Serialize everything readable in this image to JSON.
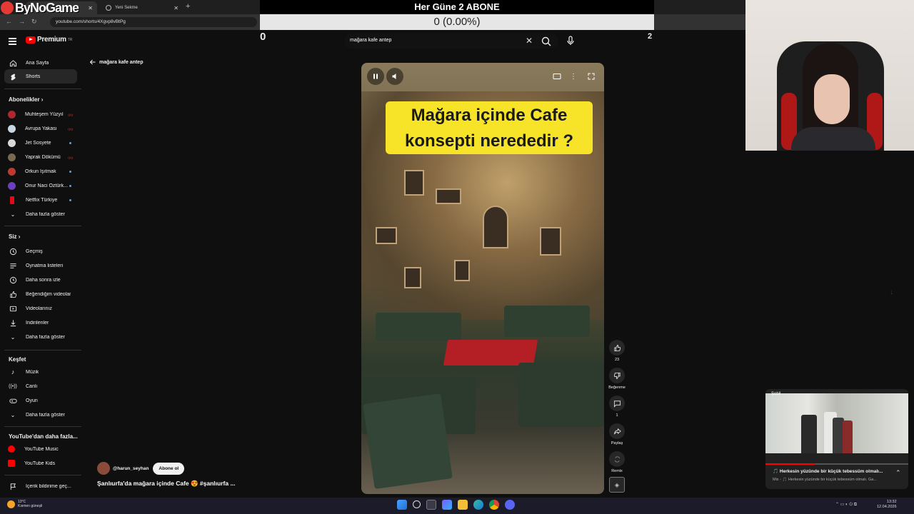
{
  "browser": {
    "tabs": [
      {
        "label": "ByNoGame"
      },
      {
        "label": "Yeni Sekme"
      }
    ],
    "url": "youtube.com/shorts/4Xgvp8vBtPg"
  },
  "overlay": {
    "title": "Her Güne 2 ABONE",
    "count": "0 (0.00%)",
    "left_value": "0",
    "right_value": "2"
  },
  "youtube": {
    "logo_text": "Premium",
    "logo_sup": "TR",
    "search_value": "mağara kafe antep",
    "back_label": "mağara kafe antep"
  },
  "sidebar": {
    "main": [
      {
        "label": "Ana Sayfa",
        "icon": "home-icon"
      },
      {
        "label": "Shorts",
        "icon": "shorts-icon"
      }
    ],
    "subscriptions_title": "Abonelikler",
    "subscriptions": [
      {
        "label": "Muhteşem Yüzyıl",
        "badge": "live",
        "color": "#b2262e"
      },
      {
        "label": "Avrupa Yakası",
        "badge": "live",
        "color": "#c7d6e3"
      },
      {
        "label": "Jet Sosyete",
        "badge": "dot",
        "color": "#d8d8d8"
      },
      {
        "label": "Yaprak Dökümü",
        "badge": "live",
        "color": "#7a6a4f"
      },
      {
        "label": "Orkun Işıtmak",
        "badge": "dot",
        "color": "#c0392b"
      },
      {
        "label": "Onur Naci Öztürk...",
        "badge": "dot",
        "color": "#6c3fbf"
      },
      {
        "label": "Netflix Türkiye",
        "badge": "dot",
        "color": "#e50914"
      }
    ],
    "show_more": "Daha fazla göster",
    "you_title": "Siz",
    "you": [
      {
        "label": "Geçmiş",
        "icon": "history-icon"
      },
      {
        "label": "Oynatma listeleri",
        "icon": "playlists-icon"
      },
      {
        "label": "Daha sonra izle",
        "icon": "watch-later-icon"
      },
      {
        "label": "Beğendiğim videolar",
        "icon": "liked-videos-icon"
      },
      {
        "label": "Videolarınız",
        "icon": "your-videos-icon"
      },
      {
        "label": "İndirilenler",
        "icon": "downloads-icon"
      },
      {
        "label": "Daha fazla göster",
        "icon": "chevron-down-icon"
      }
    ],
    "explore_title": "Keşfet",
    "explore": [
      {
        "label": "Müzik",
        "icon": "music-icon"
      },
      {
        "label": "Canlı",
        "icon": "live-icon"
      },
      {
        "label": "Oyun",
        "icon": "gaming-icon"
      },
      {
        "label": "Daha fazla göster",
        "icon": "chevron-down-icon"
      }
    ],
    "more_title": "YouTube'dan daha fazla...",
    "more": [
      {
        "label": "YouTube Music",
        "color": "#ff0000"
      },
      {
        "label": "YouTube Kids",
        "color": "#ff0000"
      }
    ],
    "report": "İçerik bildirime geç..."
  },
  "short": {
    "overlay_text_line1": "Mağara içinde Cafe",
    "overlay_text_line2": "konsepti nerededir ?",
    "channel": "@harun_seyhan",
    "subscribe_label": "Abone ol",
    "caption": "Şanlıurfa'da mağara içinde Cafe 😍 #şanlıurfa ...",
    "actions": {
      "like_count": "23",
      "dislike_label": "Beğenme",
      "comment_count": "1",
      "share_label": "Paylaş",
      "remix_label": "Remix"
    }
  },
  "miniplayer": {
    "label": "Şebil",
    "title": "🎵 Herkesin yüzünde bir küçük tebessüm olmalı...",
    "subtitle": "Mix - 🎵 Herkesin yüzünde bir küçük tebessüm olmalı. Ga...",
    "progress": 0.35
  },
  "taskbar": {
    "temp": "13°C",
    "weather": "Kısmen güneşli",
    "time": "13:32",
    "date": "12.04.2026"
  }
}
